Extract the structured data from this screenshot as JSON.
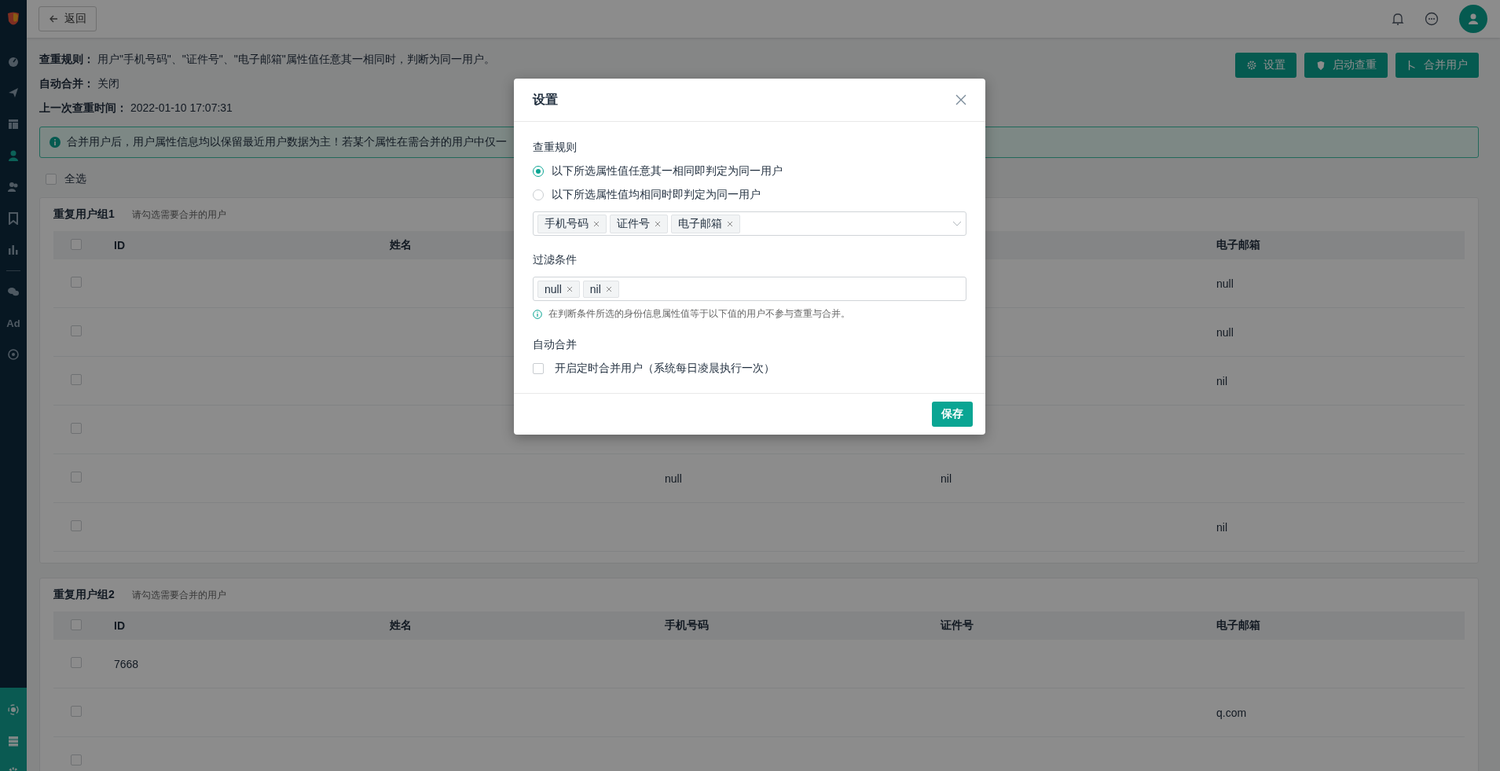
{
  "sidebar": {
    "items": [
      {
        "kind": "dashboard",
        "selected": false
      },
      {
        "kind": "send",
        "selected": false
      },
      {
        "kind": "table",
        "selected": false
      },
      {
        "kind": "user",
        "selected": true
      },
      {
        "kind": "users",
        "selected": false
      },
      {
        "kind": "bookmark",
        "selected": false
      },
      {
        "kind": "chart",
        "selected": false
      },
      {
        "kind": "chat",
        "selected": false
      },
      {
        "kind": "text",
        "label": "Ad",
        "selected": false
      },
      {
        "kind": "target",
        "selected": false
      }
    ],
    "bottom_items": [
      {
        "kind": "hub"
      },
      {
        "kind": "server"
      },
      {
        "kind": "gear"
      }
    ]
  },
  "back_button": {
    "label": "返回"
  },
  "rules": [
    {
      "label": "查重规则：",
      "value": "用户\"手机号码\"、\"证件号\"、\"电子邮箱\"属性值任意其一相同时，判断为同一用户。"
    },
    {
      "label": "自动合并：",
      "value": "关闭"
    },
    {
      "label": "上一次查重时间：",
      "value": "2022-01-10 17:07:31"
    }
  ],
  "actions": [
    {
      "kind": "settings",
      "label": "设置"
    },
    {
      "kind": "start",
      "label": "启动查重"
    },
    {
      "kind": "merge",
      "label": "合并用户"
    }
  ],
  "alert": {
    "text": "合并用户后，用户属性信息均以保留最近用户数据为主！若某个属性在需合并的用户中仅一"
  },
  "select_all": {
    "label": "全选",
    "checked": false
  },
  "groups": [
    {
      "title": "重复用户组1",
      "hint": "请勾选需要合并的用户",
      "header_checked": false,
      "columns": [
        "ID",
        "姓名",
        null,
        null,
        "电子邮箱"
      ],
      "rows": [
        {
          "checked": false,
          "email": "null"
        },
        {
          "checked": false,
          "email": "null"
        },
        {
          "checked": false,
          "email": "nil"
        },
        {
          "checked": false
        },
        {
          "checked": false,
          "phone": "null",
          "id_number": "nil"
        },
        {
          "checked": false,
          "email": "nil"
        }
      ]
    },
    {
      "title": "重复用户组2",
      "hint": "请勾选需要合并的用户",
      "header_checked": false,
      "columns": [
        "ID",
        "姓名",
        "手机号码",
        "证件号",
        "电子邮箱"
      ],
      "rows": [
        {
          "checked": false,
          "id": "7668"
        },
        {
          "checked": false,
          "email": "q.com"
        },
        {
          "checked": false
        }
      ]
    }
  ],
  "modal": {
    "title": "设置",
    "rule_label": "查重规则",
    "radios": [
      {
        "label": "以下所选属性值任意其一相同即判定为同一用户",
        "selected": true
      },
      {
        "label": "以下所选属性值均相同时即判定为同一用户",
        "selected": false
      }
    ],
    "rule_tags": [
      "手机号码",
      "证件号",
      "电子邮箱"
    ],
    "filter_label": "过滤条件",
    "filter_tags": [
      "null",
      "nil"
    ],
    "filter_hint": "在判断条件所选的身份信息属性值等于以下值的用户不参与查重与合并。",
    "auto_label": "自动合并",
    "auto_checkbox": {
      "label": "开启定时合并用户（系统每日凌晨执行一次）",
      "checked": false
    },
    "save_button": "保存"
  }
}
